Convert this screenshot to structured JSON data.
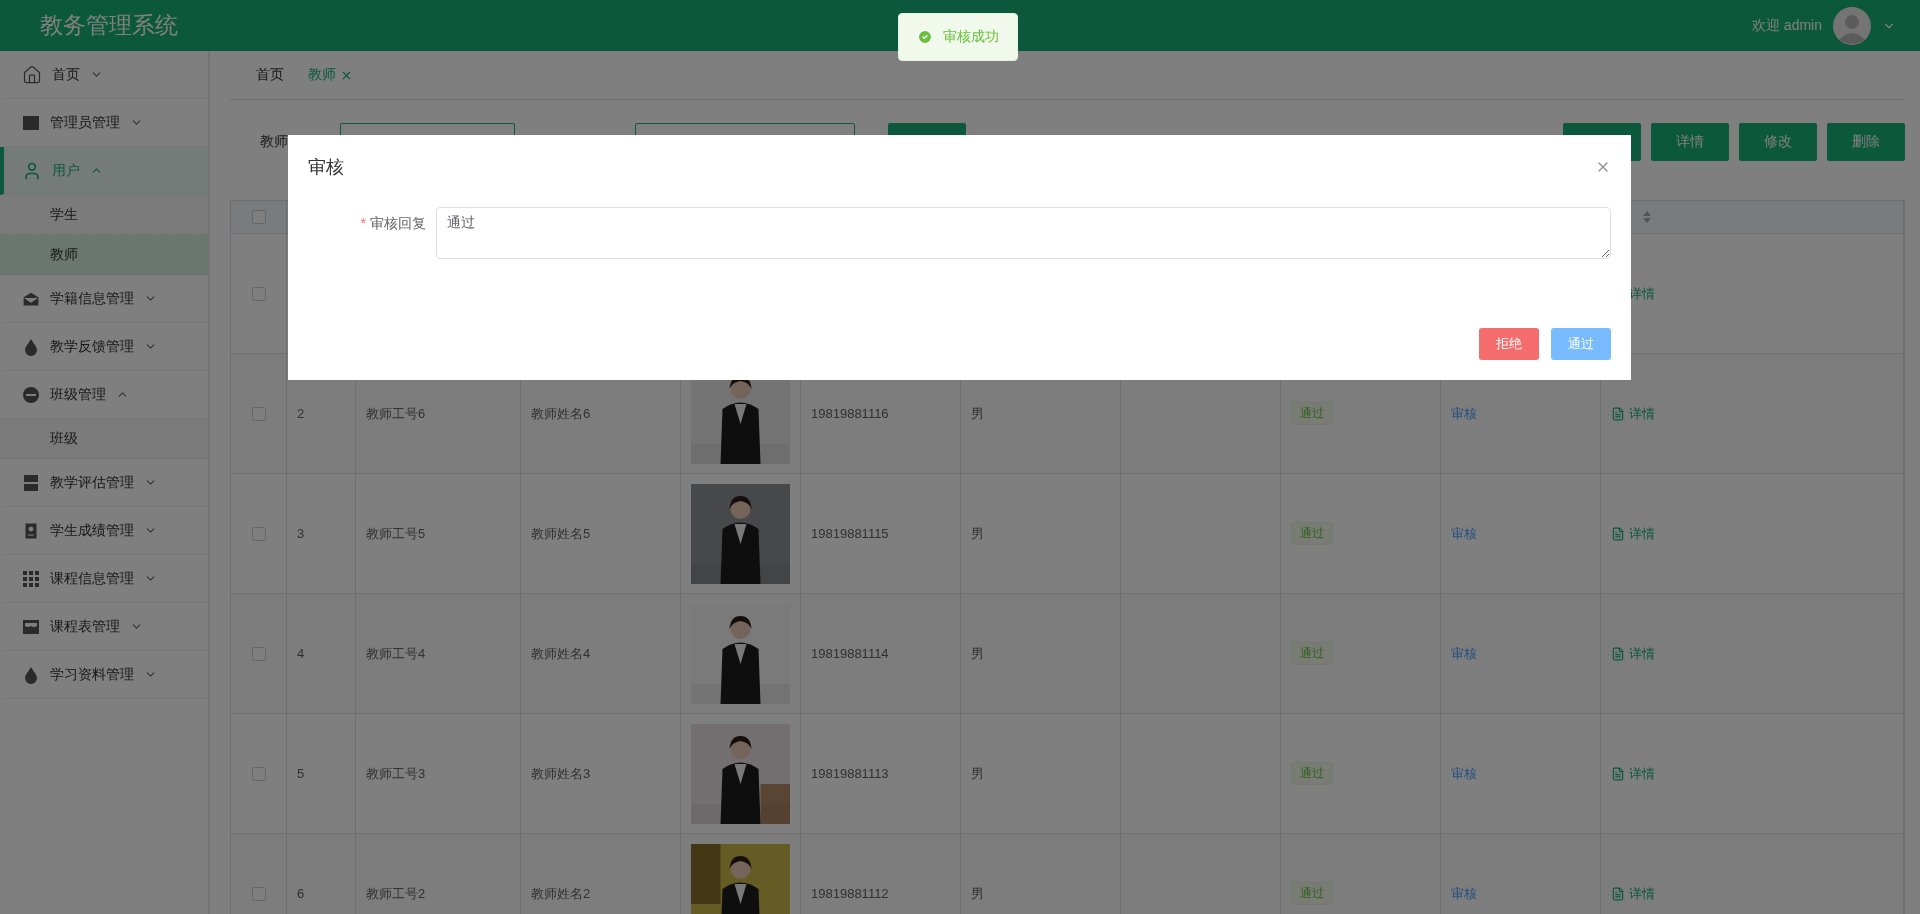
{
  "header": {
    "title": "教务管理系统",
    "welcome": "欢迎 admin"
  },
  "toast": {
    "message": "审核成功"
  },
  "sidebar": {
    "items": [
      {
        "label": "首页",
        "expanded": false,
        "selected": false
      },
      {
        "label": "管理员管理",
        "expanded": false,
        "selected": false
      },
      {
        "label": "用户",
        "expanded": true,
        "selected": true,
        "children": [
          {
            "label": "学生",
            "selected": false
          },
          {
            "label": "教师",
            "selected": true
          }
        ]
      },
      {
        "label": "学籍信息管理",
        "expanded": false,
        "selected": false
      },
      {
        "label": "教学反馈管理",
        "expanded": false,
        "selected": false
      },
      {
        "label": "班级管理",
        "expanded": true,
        "selected": false,
        "children": [
          {
            "label": "班级",
            "selected": false
          }
        ]
      },
      {
        "label": "教学评估管理",
        "expanded": false,
        "selected": false
      },
      {
        "label": "学生成绩管理",
        "expanded": false,
        "selected": false
      },
      {
        "label": "课程信息管理",
        "expanded": false,
        "selected": false
      },
      {
        "label": "课程表管理",
        "expanded": false,
        "selected": false
      },
      {
        "label": "学习资料管理",
        "expanded": false,
        "selected": false
      }
    ]
  },
  "tabs": [
    {
      "label": "首页",
      "selected": false,
      "closable": false
    },
    {
      "label": "教师",
      "selected": true,
      "closable": true
    }
  ],
  "toolbar": {
    "label": "教师",
    "buttons": [
      "详情",
      "修改",
      "删除"
    ]
  },
  "table": {
    "all_checked": false,
    "rows": [
      {
        "checked": false,
        "detail": "详情"
      },
      {
        "checked": false,
        "index": "2",
        "id": "教师工号6",
        "name": "教师姓名6",
        "phone": "19819881116",
        "gender": "男",
        "status": "通过",
        "audit": "审核",
        "detail": "详情"
      },
      {
        "checked": false,
        "index": "3",
        "id": "教师工号5",
        "name": "教师姓名5",
        "phone": "19819881115",
        "gender": "男",
        "status": "通过",
        "audit": "审核",
        "detail": "详情"
      },
      {
        "checked": false,
        "index": "4",
        "id": "教师工号4",
        "name": "教师姓名4",
        "phone": "19819881114",
        "gender": "男",
        "status": "通过",
        "audit": "审核",
        "detail": "详情"
      },
      {
        "checked": false,
        "index": "5",
        "id": "教师工号3",
        "name": "教师姓名3",
        "phone": "19819881113",
        "gender": "男",
        "status": "通过",
        "audit": "审核",
        "detail": "详情"
      },
      {
        "checked": false,
        "index": "6",
        "id": "教师工号2",
        "name": "教师姓名2",
        "phone": "19819881112",
        "gender": "男",
        "status": "通过",
        "audit": "审核",
        "detail": "详情"
      }
    ]
  },
  "dialog": {
    "title": "审核",
    "field_label": "审核回复",
    "required_mark": "*",
    "value": "通过",
    "buttons": [
      {
        "label": "拒绝",
        "kind": "danger"
      },
      {
        "label": "通过",
        "kind": "primary"
      }
    ]
  }
}
